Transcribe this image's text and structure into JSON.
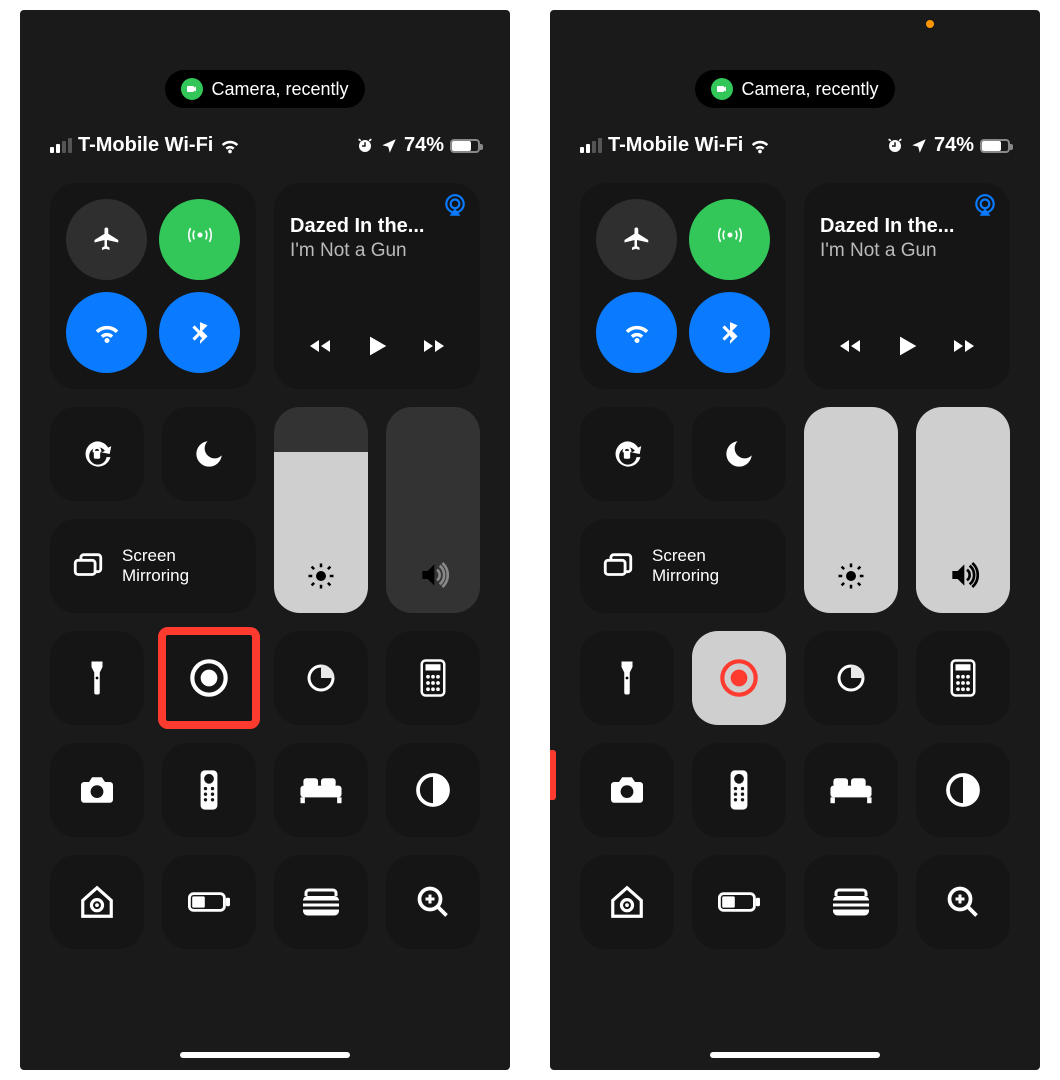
{
  "privacy_pill": {
    "label": "Camera, recently"
  },
  "status": {
    "carrier": "T-Mobile Wi-Fi",
    "battery_pct": "74%"
  },
  "music": {
    "title": "Dazed In the...",
    "artist": "I'm Not a Gun"
  },
  "mirror_label": "Screen\nMirroring",
  "sliders": {
    "brightness_pct": 78,
    "volume_pct": 0
  },
  "right_panel": {
    "brightness_pct": 100,
    "volume_pct": 100,
    "screen_record_active": true,
    "show_orange_dot": true,
    "show_red_nub": true
  }
}
